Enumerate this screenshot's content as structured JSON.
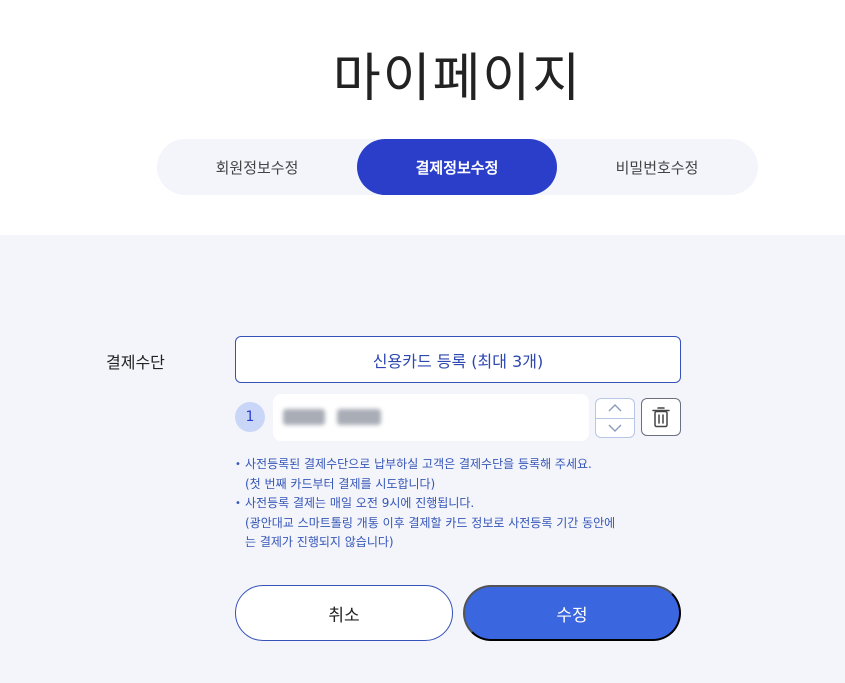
{
  "page": {
    "title": "마이페이지"
  },
  "tabs": [
    {
      "label": "회원정보수정",
      "active": false
    },
    {
      "label": "결제정보수정",
      "active": true
    },
    {
      "label": "비밀번호수정",
      "active": false
    }
  ],
  "payment": {
    "label": "결제수단",
    "register_button": "신용카드 등록 (최대 3개)",
    "cards": [
      {
        "index": "1"
      }
    ],
    "notes": [
      "사전등록된 결제수단으로 납부하실 고객은 결제수단을 등록해 주세요.",
      "(첫 번째 카드부터 결제를 시도합니다)",
      "사전등록 결제는 매일 오전 9시에 진행됩니다.",
      "(광안대교 스마트톨링 개통 이후 결제할 카드 정보로 사전등록 기간 동안에",
      "는 결제가 진행되지 않습니다)"
    ]
  },
  "actions": {
    "cancel_label": "취소",
    "submit_label": "수정"
  },
  "colors": {
    "accent": "#2a3ec9",
    "submit": "#3a66e0",
    "note_text": "#3656b8",
    "panel_bg": "#f3f5fa"
  },
  "icons": {
    "up": "chevron-up-icon",
    "down": "chevron-down-icon",
    "delete": "trash-icon"
  }
}
